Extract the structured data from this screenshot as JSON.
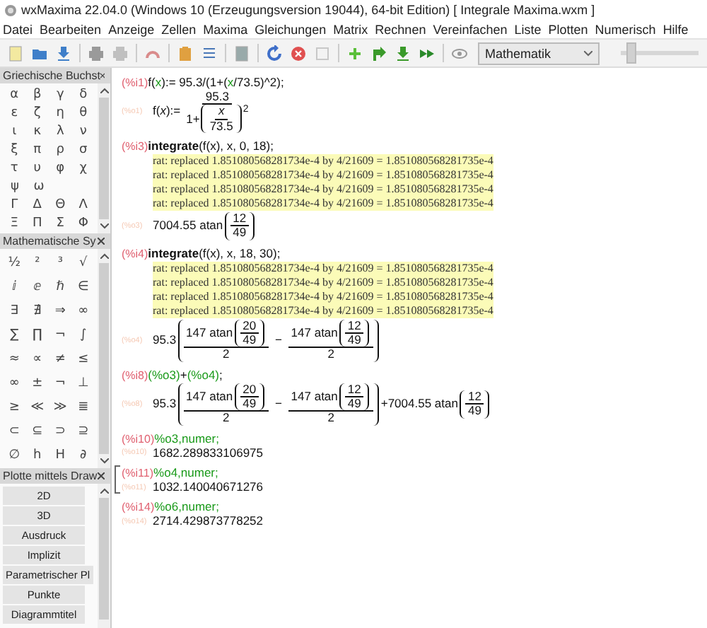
{
  "window": {
    "title": "wxMaxima 22.04.0 (Windows 10 (Erzeugungsversion 19044), 64-bit Edition)  [ Integrale Maxima.wxm ]"
  },
  "menu": [
    "Datei",
    "Bearbeiten",
    "Anzeige",
    "Zellen",
    "Maxima",
    "Gleichungen",
    "Matrix",
    "Rechnen",
    "Vereinfachen",
    "Liste",
    "Plotten",
    "Numerisch",
    "Hilfe"
  ],
  "toolbar": {
    "mode": "Mathematik",
    "zoom": {
      "level": 0.08
    }
  },
  "panels": [
    {
      "kind": "symbols",
      "title": "Griechische Buchst",
      "rows": [
        [
          "α",
          "β",
          "γ",
          "δ"
        ],
        [
          "ε",
          "ζ",
          "η",
          "θ"
        ],
        [
          "ι",
          "κ",
          "λ",
          "ν"
        ],
        [
          "ξ",
          "π",
          "ρ",
          "σ"
        ],
        [
          "τ",
          "υ",
          "φ",
          "χ"
        ],
        [
          "ψ",
          "ω"
        ],
        [
          "Γ",
          "Δ",
          "Θ",
          "Λ"
        ],
        [
          "Ξ",
          "Π",
          "Σ",
          "Φ"
        ]
      ]
    },
    {
      "kind": "symbols",
      "title": "Mathematische Sy",
      "rows": [
        [
          "½",
          "²",
          "³",
          "√"
        ],
        [
          "ⅈ",
          "ⅇ",
          "ℏ",
          "∈"
        ],
        [
          "∃",
          "∄",
          "⇒",
          "∞"
        ],
        [
          "∑",
          "∏",
          "¬",
          "∫"
        ],
        [
          "≈",
          "∝",
          "≠",
          "≤"
        ],
        [
          "∞",
          "±",
          "¬",
          "⊥"
        ],
        [
          "≥",
          "≪",
          "≫",
          "≣"
        ],
        [
          "⊂",
          "⊆",
          "⊃",
          "⊇"
        ],
        [
          "∅",
          "h",
          "H",
          "∂"
        ]
      ]
    },
    {
      "kind": "buttons",
      "title": "Plotte mittels Draw",
      "items": [
        "2D",
        "3D",
        "Ausdruck",
        "Implizit",
        "Parametrischer Pl",
        "Punkte",
        "Diagrammtitel"
      ]
    }
  ],
  "cells": [
    {
      "selected": false,
      "input_label": "(%i1)",
      "input": [
        {
          "kind": "plain",
          "text": "f("
        },
        {
          "kind": "var",
          "text": "x"
        },
        {
          "kind": "plain",
          "text": "):= 95.3/(1+("
        },
        {
          "kind": "var",
          "text": "x"
        },
        {
          "kind": "plain",
          "text": "/73.5)^2);"
        }
      ],
      "output_label": "(%o1)",
      "output": [
        "f(",
        {
          "kind": "var",
          "text": "x"
        },
        "):=",
        {
          "kind": "frac",
          "num": [
            "95.3"
          ],
          "den": [
            "1+",
            {
              "kind": "paren",
              "body": [
                {
                  "kind": "frac",
                  "num": [
                    {
                      "kind": "var",
                      "text": "x"
                    }
                  ],
                  "den": [
                    "73.5"
                  ]
                }
              ],
              "sup": "2"
            }
          ]
        }
      ]
    },
    {
      "selected": false,
      "input_label": "(%i3)",
      "input": [
        {
          "kind": "cmd",
          "text": "integrate"
        },
        {
          "kind": "plain",
          "text": "(f(x), x, 0, 18);"
        }
      ],
      "warnings": [
        "rat: replaced 1.851080568281734e-4 by 4/21609 = 1.851080568281735e-4",
        "rat: replaced 1.851080568281734e-4 by 4/21609 = 1.851080568281735e-4",
        "rat: replaced 1.851080568281734e-4 by 4/21609 = 1.851080568281735e-4",
        "rat: replaced 1.851080568281734e-4 by 4/21609 = 1.851080568281735e-4"
      ],
      "output_label": "(%o3)",
      "output": [
        "7004.55 atan",
        {
          "kind": "paren",
          "body": [
            {
              "kind": "frac",
              "num": [
                "12"
              ],
              "den": [
                "49"
              ]
            }
          ]
        }
      ]
    },
    {
      "selected": false,
      "input_label": "(%i4)",
      "input": [
        {
          "kind": "cmd",
          "text": "integrate"
        },
        {
          "kind": "plain",
          "text": "(f(x), x, 18, 30);"
        }
      ],
      "warnings": [
        "rat: replaced 1.851080568281734e-4 by 4/21609 = 1.851080568281735e-4",
        "rat: replaced 1.851080568281734e-4 by 4/21609 = 1.851080568281735e-4",
        "rat: replaced 1.851080568281734e-4 by 4/21609 = 1.851080568281735e-4",
        "rat: replaced 1.851080568281734e-4 by 4/21609 = 1.851080568281735e-4"
      ],
      "output_label": "(%o4)",
      "output": [
        "95.3",
        {
          "kind": "paren",
          "body": [
            {
              "kind": "frac",
              "num": [
                "147 atan",
                {
                  "kind": "paren",
                  "body": [
                    {
                      "kind": "frac",
                      "num": [
                        "20"
                      ],
                      "den": [
                        "49"
                      ]
                    }
                  ]
                }
              ],
              "den": [
                "2"
              ]
            },
            " − ",
            {
              "kind": "frac",
              "num": [
                "147 atan",
                {
                  "kind": "paren",
                  "body": [
                    {
                      "kind": "frac",
                      "num": [
                        "12"
                      ],
                      "den": [
                        "49"
                      ]
                    }
                  ]
                }
              ],
              "den": [
                "2"
              ]
            }
          ]
        }
      ]
    },
    {
      "selected": false,
      "input_label": "(%i8)",
      "input": [
        {
          "kind": "var",
          "text": "(%o3)"
        },
        {
          "kind": "plain",
          "text": "+"
        },
        {
          "kind": "var",
          "text": "(%o4)"
        },
        {
          "kind": "plain",
          "text": ";"
        }
      ],
      "output_label": "(%o8)",
      "output": [
        "95.3",
        {
          "kind": "paren",
          "body": [
            {
              "kind": "frac",
              "num": [
                "147 atan",
                {
                  "kind": "paren",
                  "body": [
                    {
                      "kind": "frac",
                      "num": [
                        "20"
                      ],
                      "den": [
                        "49"
                      ]
                    }
                  ]
                }
              ],
              "den": [
                "2"
              ]
            },
            " − ",
            {
              "kind": "frac",
              "num": [
                "147 atan",
                {
                  "kind": "paren",
                  "body": [
                    {
                      "kind": "frac",
                      "num": [
                        "12"
                      ],
                      "den": [
                        "49"
                      ]
                    }
                  ]
                }
              ],
              "den": [
                "2"
              ]
            }
          ]
        },
        "+7004.55 atan",
        {
          "kind": "paren",
          "body": [
            {
              "kind": "frac",
              "num": [
                "12"
              ],
              "den": [
                "49"
              ]
            }
          ]
        }
      ]
    },
    {
      "selected": false,
      "input_label": "(%i10)",
      "input": [
        {
          "kind": "var",
          "text": "%o3,numer;"
        }
      ],
      "output_label": "(%o10)",
      "output": [
        "1682.289833106975"
      ]
    },
    {
      "selected": true,
      "input_label": "(%i11)",
      "input": [
        {
          "kind": "var",
          "text": "%o4,numer;"
        }
      ],
      "output_label": "(%o11)",
      "output": [
        "1032.140040671276"
      ]
    },
    {
      "selected": false,
      "input_label": "(%i14)",
      "input": [
        {
          "kind": "var",
          "text": "%o6,numer;"
        }
      ],
      "output_label": "(%o14)",
      "output": [
        "2714.429873778252"
      ]
    }
  ]
}
